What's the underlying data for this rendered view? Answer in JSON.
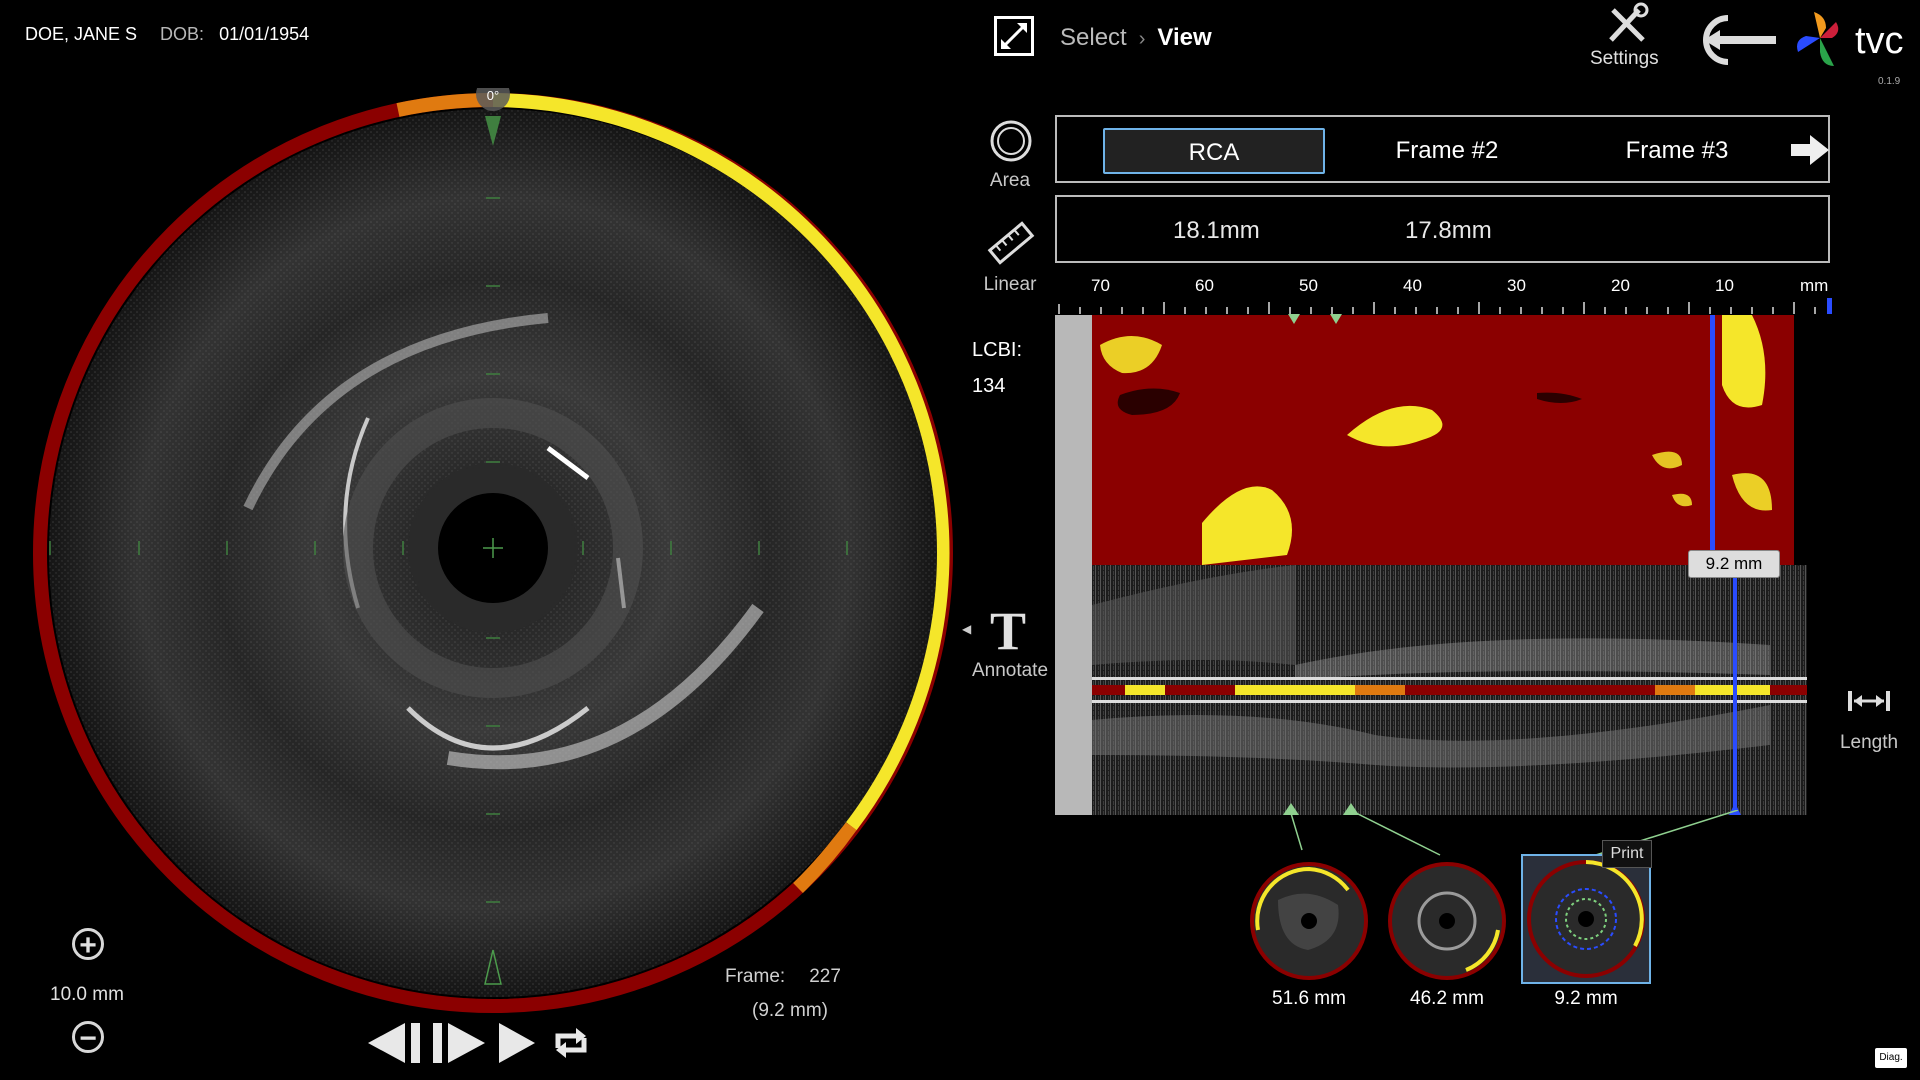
{
  "patient": {
    "name": "DOE, JANE S",
    "dob_label": "DOB:",
    "dob": "01/01/1954"
  },
  "ivus": {
    "angle_label": "0°"
  },
  "zoom": {
    "label": "10.0 mm"
  },
  "frame": {
    "label": "Frame:",
    "number": "227",
    "position": "(9.2 mm)"
  },
  "header": {
    "breadcrumb_select": "Select",
    "breadcrumb_separator": "›",
    "breadcrumb_view": "View",
    "settings_label": "Settings",
    "brand": "tvc",
    "version": "0.1.9"
  },
  "tools": {
    "area": "Area",
    "linear": "Linear",
    "annotate": "Annotate",
    "length": "Length"
  },
  "tabs": [
    {
      "label": "RCA",
      "active": true
    },
    {
      "label": "Frame #2",
      "active": false
    },
    {
      "label": "Frame #3",
      "active": false
    }
  ],
  "measurements": [
    "18.1mm",
    "17.8mm"
  ],
  "lcbi": {
    "label": "LCBI:",
    "value": "134"
  },
  "ruler": {
    "ticks": [
      "70",
      "60",
      "50",
      "40",
      "30",
      "20",
      "10"
    ],
    "unit": "mm",
    "range_mm": [
      0,
      75
    ]
  },
  "cursor": {
    "position_mm": 9.2,
    "label": "9.2 mm"
  },
  "thumbnails": [
    {
      "label": "51.6 mm",
      "selected": false
    },
    {
      "label": "46.2 mm",
      "selected": false
    },
    {
      "label": "9.2 mm",
      "selected": true
    }
  ],
  "print_label": "Print",
  "diag_label": "Diag.",
  "colors": {
    "accent_blue": "#2a4cff",
    "lipid_yellow": "#f5e62a",
    "fibrous_red": "#8b0000",
    "tab_border": "#6fb3e8"
  },
  "icons": [
    "expand-icon",
    "settings-icon",
    "back-icon",
    "area-icon",
    "ruler-icon",
    "annotate-icon",
    "length-icon",
    "zoom-in-icon",
    "zoom-out-icon",
    "step-back-icon",
    "step-forward-icon",
    "play-icon",
    "loop-icon",
    "arrow-right-icon"
  ]
}
